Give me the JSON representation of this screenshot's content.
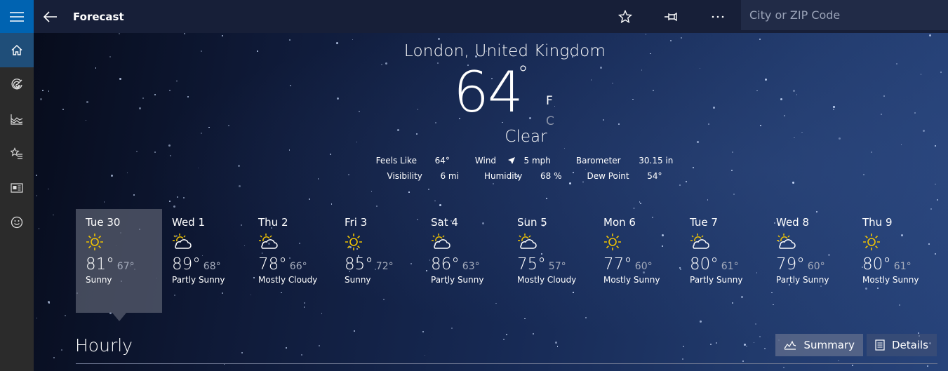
{
  "app": {
    "title": "Forecast",
    "search_placeholder": "City or ZIP Code",
    "search_value": ""
  },
  "nav": {
    "items": [
      {
        "name": "home",
        "icon": "home-icon",
        "active": true
      },
      {
        "name": "maps",
        "icon": "radar-icon",
        "active": false
      },
      {
        "name": "historical-weather",
        "icon": "chart-icon",
        "active": false
      },
      {
        "name": "favorites",
        "icon": "star-list-icon",
        "active": false
      },
      {
        "name": "news",
        "icon": "news-icon",
        "active": false
      },
      {
        "name": "feedback",
        "icon": "smiley-icon",
        "active": false
      }
    ]
  },
  "toolbar": {
    "favorite_icon": "star-icon",
    "pin_icon": "pin-icon",
    "more_icon": "more-icon"
  },
  "current": {
    "location": "London, United Kingdom",
    "temperature": "64",
    "degree": "°",
    "unit_f": "F",
    "unit_c": "C",
    "selected_unit": "F",
    "condition": "Clear",
    "feels_like_label": "Feels Like",
    "feels_like": "64°",
    "wind_label": "Wind",
    "wind": "5 mph",
    "barometer_label": "Barometer",
    "barometer": "30.15 in",
    "visibility_label": "Visibility",
    "visibility": "6 mi",
    "humidity_label": "Humidity",
    "humidity": "68 %",
    "dew_point_label": "Dew Point",
    "dew_point": "54°"
  },
  "daily": [
    {
      "day": "Tue 30",
      "hi": "81°",
      "lo": "67°",
      "condition": "Sunny",
      "icon": "sunny",
      "selected": true
    },
    {
      "day": "Wed 1",
      "hi": "89°",
      "lo": "68°",
      "condition": "Partly Sunny",
      "icon": "partly-sunny",
      "selected": false
    },
    {
      "day": "Thu 2",
      "hi": "78°",
      "lo": "66°",
      "condition": "Mostly Cloudy",
      "icon": "partly-sunny",
      "selected": false
    },
    {
      "day": "Fri 3",
      "hi": "85°",
      "lo": "72°",
      "condition": "Sunny",
      "icon": "sunny",
      "selected": false
    },
    {
      "day": "Sat 4",
      "hi": "86°",
      "lo": "63°",
      "condition": "Partly Sunny",
      "icon": "partly-sunny",
      "selected": false
    },
    {
      "day": "Sun 5",
      "hi": "75°",
      "lo": "57°",
      "condition": "Mostly Cloudy",
      "icon": "partly-sunny",
      "selected": false
    },
    {
      "day": "Mon 6",
      "hi": "77°",
      "lo": "60°",
      "condition": "Mostly Sunny",
      "icon": "sunny",
      "selected": false
    },
    {
      "day": "Tue 7",
      "hi": "80°",
      "lo": "61°",
      "condition": "Partly Sunny",
      "icon": "partly-sunny",
      "selected": false
    },
    {
      "day": "Wed 8",
      "hi": "79°",
      "lo": "60°",
      "condition": "Partly Sunny",
      "icon": "partly-sunny",
      "selected": false
    },
    {
      "day": "Thu 9",
      "hi": "80°",
      "lo": "61°",
      "condition": "Mostly Sunny",
      "icon": "sunny",
      "selected": false
    }
  ],
  "hourly": {
    "title": "Hourly",
    "summary_label": "Summary",
    "details_label": "Details",
    "active_view": "Summary"
  },
  "colors": {
    "accent": "#0063b1",
    "sun": "#f2c500",
    "rail": "#2b2b2b",
    "topbar": "#171f38"
  }
}
